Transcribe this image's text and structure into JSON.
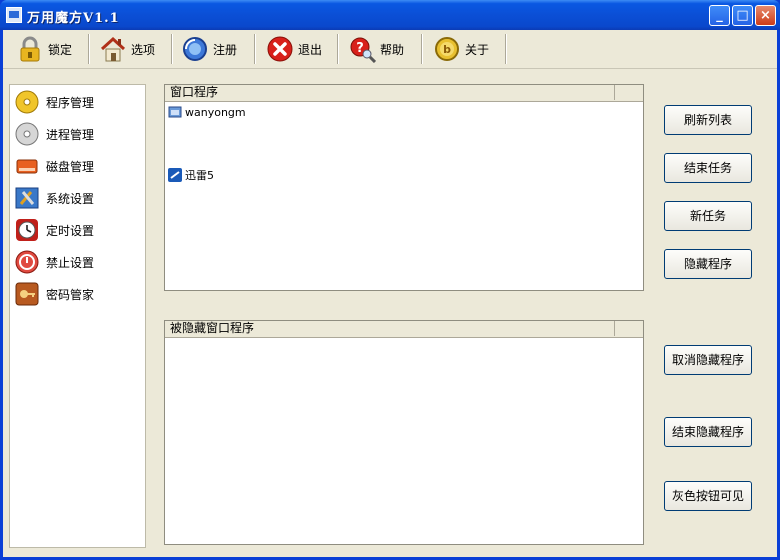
{
  "window": {
    "title": "万用魔方V1.1",
    "minimize": "_",
    "maximize": "□",
    "close": "×"
  },
  "toolbar": [
    {
      "id": "lock",
      "label": "锁定",
      "icon": "lock-icon"
    },
    {
      "id": "options",
      "label": "选项",
      "icon": "house-icon"
    },
    {
      "id": "register",
      "label": "注册",
      "icon": "globe-icon"
    },
    {
      "id": "exit",
      "label": "退出",
      "icon": "exit-icon"
    },
    {
      "id": "help",
      "label": "帮助",
      "icon": "help-magnifier-icon"
    },
    {
      "id": "about",
      "label": "关于",
      "icon": "about-coin-icon"
    }
  ],
  "sidebar": {
    "items": [
      {
        "label": "程序管理",
        "icon": "cd-gold-icon"
      },
      {
        "label": "进程管理",
        "icon": "cd-silver-icon"
      },
      {
        "label": "磁盘管理",
        "icon": "disk-icon"
      },
      {
        "label": "系统设置",
        "icon": "tools-icon"
      },
      {
        "label": "定时设置",
        "icon": "clock-icon"
      },
      {
        "label": "禁止设置",
        "icon": "forbid-icon"
      },
      {
        "label": "密码管家",
        "icon": "password-icon"
      }
    ]
  },
  "window_list": {
    "header": "窗口程序",
    "rows": [
      {
        "label": "wanyongm",
        "icon": "app-window-icon"
      },
      {
        "label": "迅雷5",
        "icon": "thunder-icon"
      }
    ]
  },
  "hidden_list": {
    "header": "被隐藏窗口程序"
  },
  "buttons": {
    "refresh": "刷新列表",
    "end_task": "结束任务",
    "new_task": "新任务",
    "hide": "隐藏程序",
    "unhide": "取消隐藏程序",
    "end_hidden": "结束隐藏程序",
    "gray_visible": "灰色按钮可见"
  },
  "colors": {
    "titlebar": "#0a58e2",
    "face": "#ece9d8",
    "button_border": "#003c74"
  }
}
